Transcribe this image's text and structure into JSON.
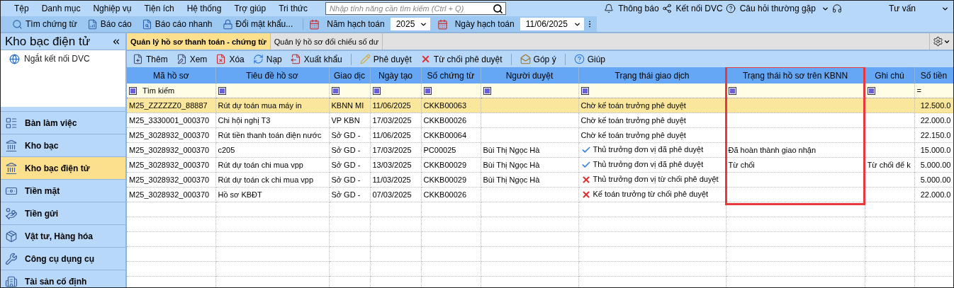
{
  "menu": [
    "Tệp",
    "Danh mục",
    "Nghiệp vụ",
    "Tiện ích",
    "Hệ thống",
    "Trợ giúp",
    "Tri thức"
  ],
  "search": {
    "placeholder": "Nhập tính năng cần tìm kiếm (Ctrl + Q)"
  },
  "top_links": [
    {
      "label": "Thông báo",
      "dropdown": false
    },
    {
      "label": "Kết nối DVC",
      "dropdown": false
    },
    {
      "label": "Câu hỏi thường gặp",
      "dropdown": true
    },
    {
      "label": "Tư vấn",
      "dropdown": true
    }
  ],
  "toolbar": [
    "Tìm chứng từ",
    "Báo cáo",
    "Báo cáo nhanh",
    "Đổi mật khẩu..."
  ],
  "year": {
    "label": "Năm hạch toán",
    "value": "2025"
  },
  "date": {
    "label": "Ngày hạch toán",
    "value": "11/06/2025"
  },
  "sidebar": {
    "title": "Kho bạc điện tử",
    "status": "Ngắt kết nối DVC",
    "items": [
      {
        "label": "Bàn làm việc",
        "selected": false
      },
      {
        "label": "Kho bạc",
        "selected": false
      },
      {
        "label": "Kho bạc điện tử",
        "selected": true
      },
      {
        "label": "Tiền mặt",
        "selected": false
      },
      {
        "label": "Tiền gửi",
        "selected": false
      },
      {
        "label": "Vật tư, Hàng hóa",
        "selected": false
      },
      {
        "label": "Công cụ dụng cụ",
        "selected": false
      },
      {
        "label": "Tài sản cố định",
        "selected": false
      }
    ]
  },
  "tabs": [
    {
      "label": "Quản lý hồ sơ thanh toán - chứng từ",
      "selected": true
    },
    {
      "label": "Quản lý hồ sơ đối chiếu số dư",
      "selected": false
    }
  ],
  "actions": [
    [
      "Thêm",
      "Xem",
      "Xóa",
      "Nạp",
      "Xuất khẩu"
    ],
    [
      "Phê duyệt",
      "Từ chối phê duyệt"
    ],
    [
      "Góp ý"
    ],
    [
      "Giúp"
    ]
  ],
  "table": {
    "columns": [
      {
        "label": "Mã hồ sơ",
        "filter_text": "Tìm kiếm",
        "highlighted": false
      },
      {
        "label": "Tiêu đề hồ sơ",
        "highlighted": false
      },
      {
        "label": "Giao dịc",
        "highlighted": false
      },
      {
        "label": "Ngày tạo",
        "highlighted": false
      },
      {
        "label": "Số chứng từ",
        "highlighted": false
      },
      {
        "label": "Người duyệt",
        "highlighted": false
      },
      {
        "label": "Trạng thái giao dịch",
        "highlighted": false
      },
      {
        "label": "Trạng thái hồ sơ trên KBNN",
        "highlighted": true
      },
      {
        "label": "Ghi chú",
        "highlighted": false
      },
      {
        "label": "Số tiền",
        "filter_text": "=",
        "highlighted": false
      }
    ],
    "rows": [
      {
        "selected": true,
        "kind": "none",
        "cells": [
          "M25_ZZZZZZ0_88887",
          "Rút dự toán mua máy in",
          "KBNN MI",
          "11/06/2025",
          "CKKB00063",
          null,
          "Chờ kế toán trưởng phê duyệt",
          null,
          null,
          "12.500.0"
        ]
      },
      {
        "selected": false,
        "kind": "none",
        "cells": [
          "M25_3330001_000370",
          "Chi hội nghị T3",
          "VP KBN",
          "17/03/2025",
          "CKKB00026",
          null,
          "Chờ kế toán trưởng phê duyệt",
          null,
          null,
          "22.000.0"
        ]
      },
      {
        "selected": false,
        "kind": "none",
        "cells": [
          "M25_3028932_000370",
          "Rút tiền thanh toán điện nước",
          "Sở GD -",
          "11/06/2025",
          "CKKB00064",
          null,
          "Chờ kế toán trưởng phê duyệt",
          null,
          null,
          "22.150.0"
        ]
      },
      {
        "selected": false,
        "kind": "check",
        "cells": [
          "M25_3028932_000370",
          "c205",
          "Sở GD -",
          "17/03/2025",
          "PC00025",
          "Bùi Thị Ngọc Hà",
          "Thủ trưởng đơn vị đã phê duyệt",
          "Đã hoàn thành giao nhận",
          null,
          "15.000.0"
        ]
      },
      {
        "selected": false,
        "kind": "check",
        "cells": [
          "M25_3028932_000370",
          "Rút dự toán chi mua vpp",
          "Sở GD -",
          "13/03/2025",
          "CKKB00029",
          "Bùi Thị Ngọc Hà",
          "Thủ trưởng đơn vị đã phê duyệt",
          "Từ chối",
          "Từ chối để k",
          "5.000.00"
        ]
      },
      {
        "selected": false,
        "kind": "cross",
        "cells": [
          "M25_3028932_000370",
          "Rút dự toán ck chi mua vpp",
          "Sở GD -",
          "11/03/2025",
          "CKKB00029",
          "Bùi Thị Ngọc Hà",
          "Thủ trưởng đơn vị từ chối phê duyệt",
          null,
          null,
          "5.000.00"
        ]
      },
      {
        "selected": false,
        "kind": "cross",
        "cells": [
          "M25_3028932_000370",
          "Hồ sơ KBĐT",
          "Sở GD -",
          "07/03/2025",
          "CKKB00026",
          null,
          "Kế toán trưởng từ chối phê duyệt",
          null,
          null,
          "22.000.0"
        ]
      }
    ]
  }
}
